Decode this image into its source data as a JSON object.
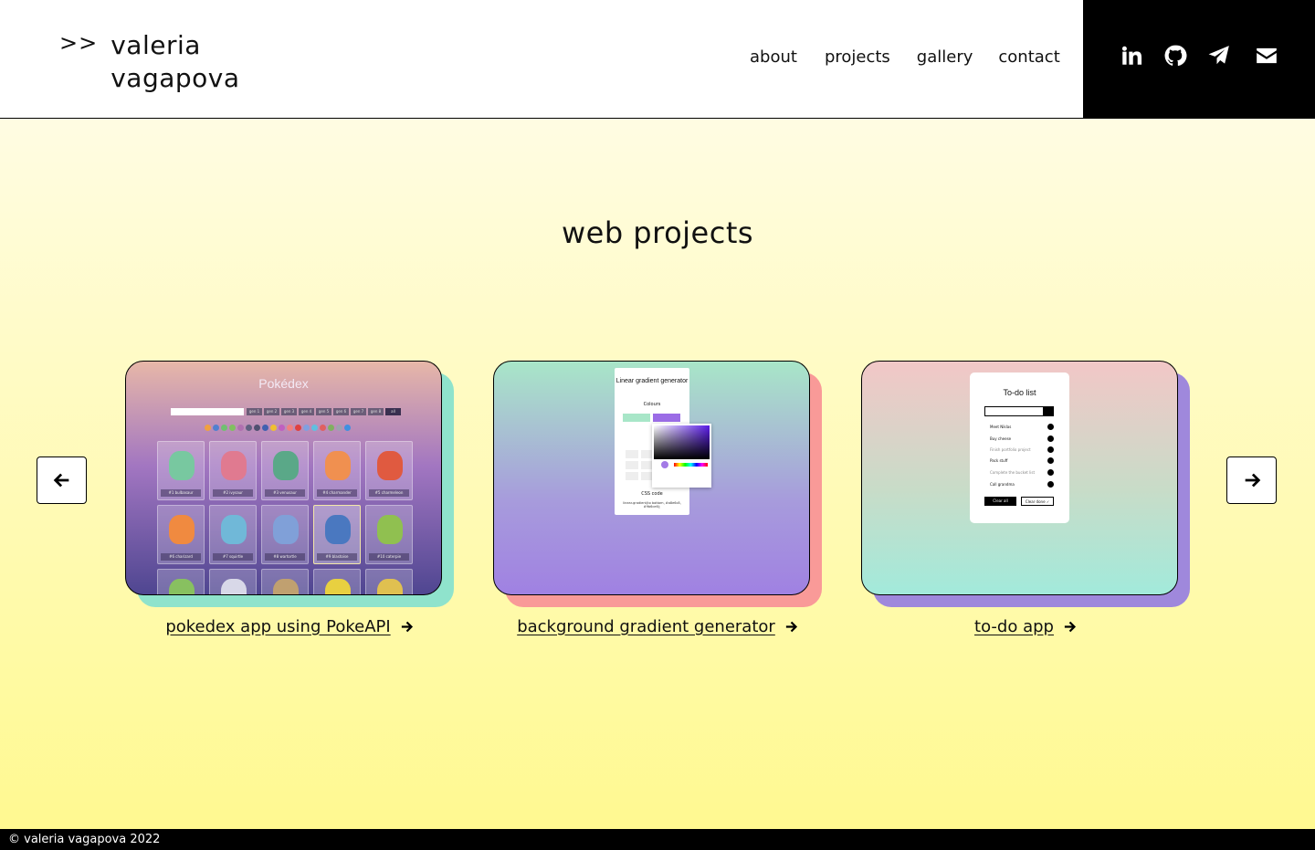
{
  "header": {
    "logo_arrows": ">>",
    "name_line1": "valeria",
    "name_line2": "vagapova",
    "nav": [
      "about",
      "projects",
      "gallery",
      "contact"
    ],
    "social_icons": [
      "linkedin-icon",
      "github-icon",
      "telegram-icon",
      "email-icon"
    ]
  },
  "main": {
    "title": "web projects",
    "projects": [
      {
        "label": "pokedex app using PokeAPI",
        "preview": {
          "title": "Pokédex",
          "gens": [
            "gen 1",
            "gen 2",
            "gen 3",
            "gen 4",
            "gen 5",
            "gen 6",
            "gen 7",
            "gen 8",
            "all"
          ],
          "cards": [
            "#1 bulbasaur",
            "#2 ivysaur",
            "#3 venusaur",
            "#4 charmander",
            "#5 charmeleon",
            "#6 charizard",
            "#7 squirtle",
            "#8 wartortle",
            "#9 blastoise",
            "#10 caterpie",
            "",
            "",
            "",
            "",
            ""
          ]
        }
      },
      {
        "label": "background gradient generator",
        "preview": {
          "title": "Linear gradient generator",
          "colours": "Colours",
          "css_code": "CSS code",
          "code": "linear-gradient(to bottom, #a8e6c8, #9b6ce6);"
        }
      },
      {
        "label": "to-do app",
        "preview": {
          "title": "To-do list",
          "items": [
            "Meet Niklas",
            "Buy cheese",
            "Finish portfolio project",
            "Pack stuff",
            "Complete the bucket list",
            "Call grandma"
          ],
          "clear_all": "Clear all",
          "clear_done": "Clear done ✓"
        }
      }
    ]
  },
  "colors": {
    "pokedex_shadow": "#8fe3cc",
    "gradient_shadow": "#f99a98",
    "todo_shadow": "#9f88dc"
  },
  "footer": {
    "text": "© valeria vagapova 2022"
  }
}
